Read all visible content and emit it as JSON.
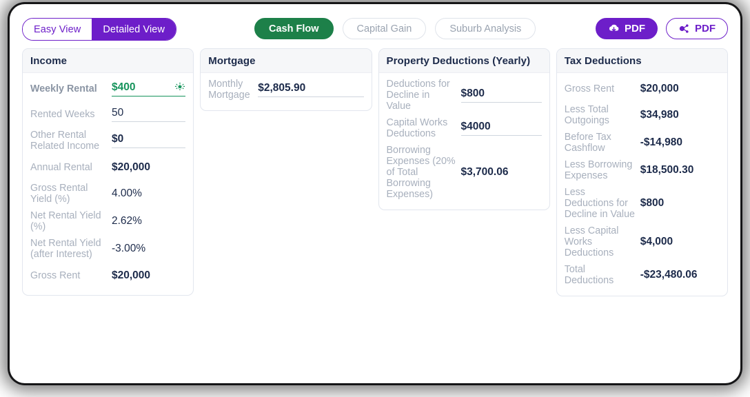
{
  "toolbar": {
    "view_toggle": [
      {
        "label": "Easy View",
        "active": false
      },
      {
        "label": "Detailed View",
        "active": true
      }
    ],
    "tabs": [
      {
        "label": "Cash Flow",
        "active": true
      },
      {
        "label": "Capital Gain",
        "active": false
      },
      {
        "label": "Suburb Analysis",
        "active": false
      }
    ],
    "pdf_download_label": "PDF",
    "pdf_share_label": "PDF",
    "download_icon": "cloud-download-icon",
    "share_icon": "share-nodes-icon"
  },
  "colors": {
    "brand_purple": "#6d1ec9",
    "accent_green": "#1d8049",
    "value_green": "#15935b",
    "navy": "#1c2a4a",
    "label_grey": "#a8b0bd"
  },
  "cards": [
    {
      "title": "Income",
      "rows": [
        {
          "label": "Weekly Rental",
          "value": "$400",
          "editable": true,
          "green": true,
          "highlight": true,
          "sparkle": true,
          "bold": true
        },
        {
          "label": "Rented Weeks",
          "value": "50",
          "editable": true,
          "bold": false
        },
        {
          "label": "Other Rental Related Income",
          "value": "$0",
          "editable": true,
          "bold": true
        },
        {
          "label": "Annual Rental",
          "value": "$20,000",
          "editable": false,
          "bold": true
        },
        {
          "label": "Gross Rental Yield (%)",
          "value": "4.00%",
          "editable": false,
          "bold": false
        },
        {
          "label": "Net Rental Yield (%)",
          "value": "2.62%",
          "editable": false,
          "bold": false
        },
        {
          "label": "Net Rental Yield (after Interest)",
          "value": "-3.00%",
          "editable": false,
          "bold": false
        },
        {
          "label": "Gross Rent",
          "value": "$20,000",
          "editable": false,
          "bold": true
        }
      ]
    },
    {
      "title": "Mortgage",
      "rows": [
        {
          "label": "Monthly Mortgage",
          "value": "$2,805.90",
          "editable": true,
          "bold": true
        }
      ]
    },
    {
      "title": "Property Deductions (Yearly)",
      "rows": [
        {
          "label": "Deductions for Decline in Value",
          "value": "$800",
          "editable": true,
          "bold": true
        },
        {
          "label": "Capital Works Deductions",
          "value": "$4000",
          "editable": true,
          "bold": true
        },
        {
          "label": "Borrowing Expenses (20% of Total Borrowing Expenses)",
          "value": "$3,700.06",
          "editable": false,
          "bold": true
        }
      ]
    },
    {
      "title": "Tax Deductions",
      "rows": [
        {
          "label": "Gross Rent",
          "value": "$20,000",
          "editable": false,
          "bold": true
        },
        {
          "label": "Less Total Outgoings",
          "value": "$34,980",
          "editable": false,
          "bold": true
        },
        {
          "label": "Before Tax Cashflow",
          "value": "-$14,980",
          "editable": false,
          "bold": true
        },
        {
          "label": "Less Borrowing Expenses",
          "value": "$18,500.30",
          "editable": false,
          "bold": true
        },
        {
          "label": "Less Deductions for Decline in Value",
          "value": "$800",
          "editable": false,
          "bold": true
        },
        {
          "label": "Less Capital Works Deductions",
          "value": "$4,000",
          "editable": false,
          "bold": true
        },
        {
          "label": "Total Deductions",
          "value": "-$23,480.06",
          "editable": false,
          "bold": true
        }
      ]
    }
  ]
}
